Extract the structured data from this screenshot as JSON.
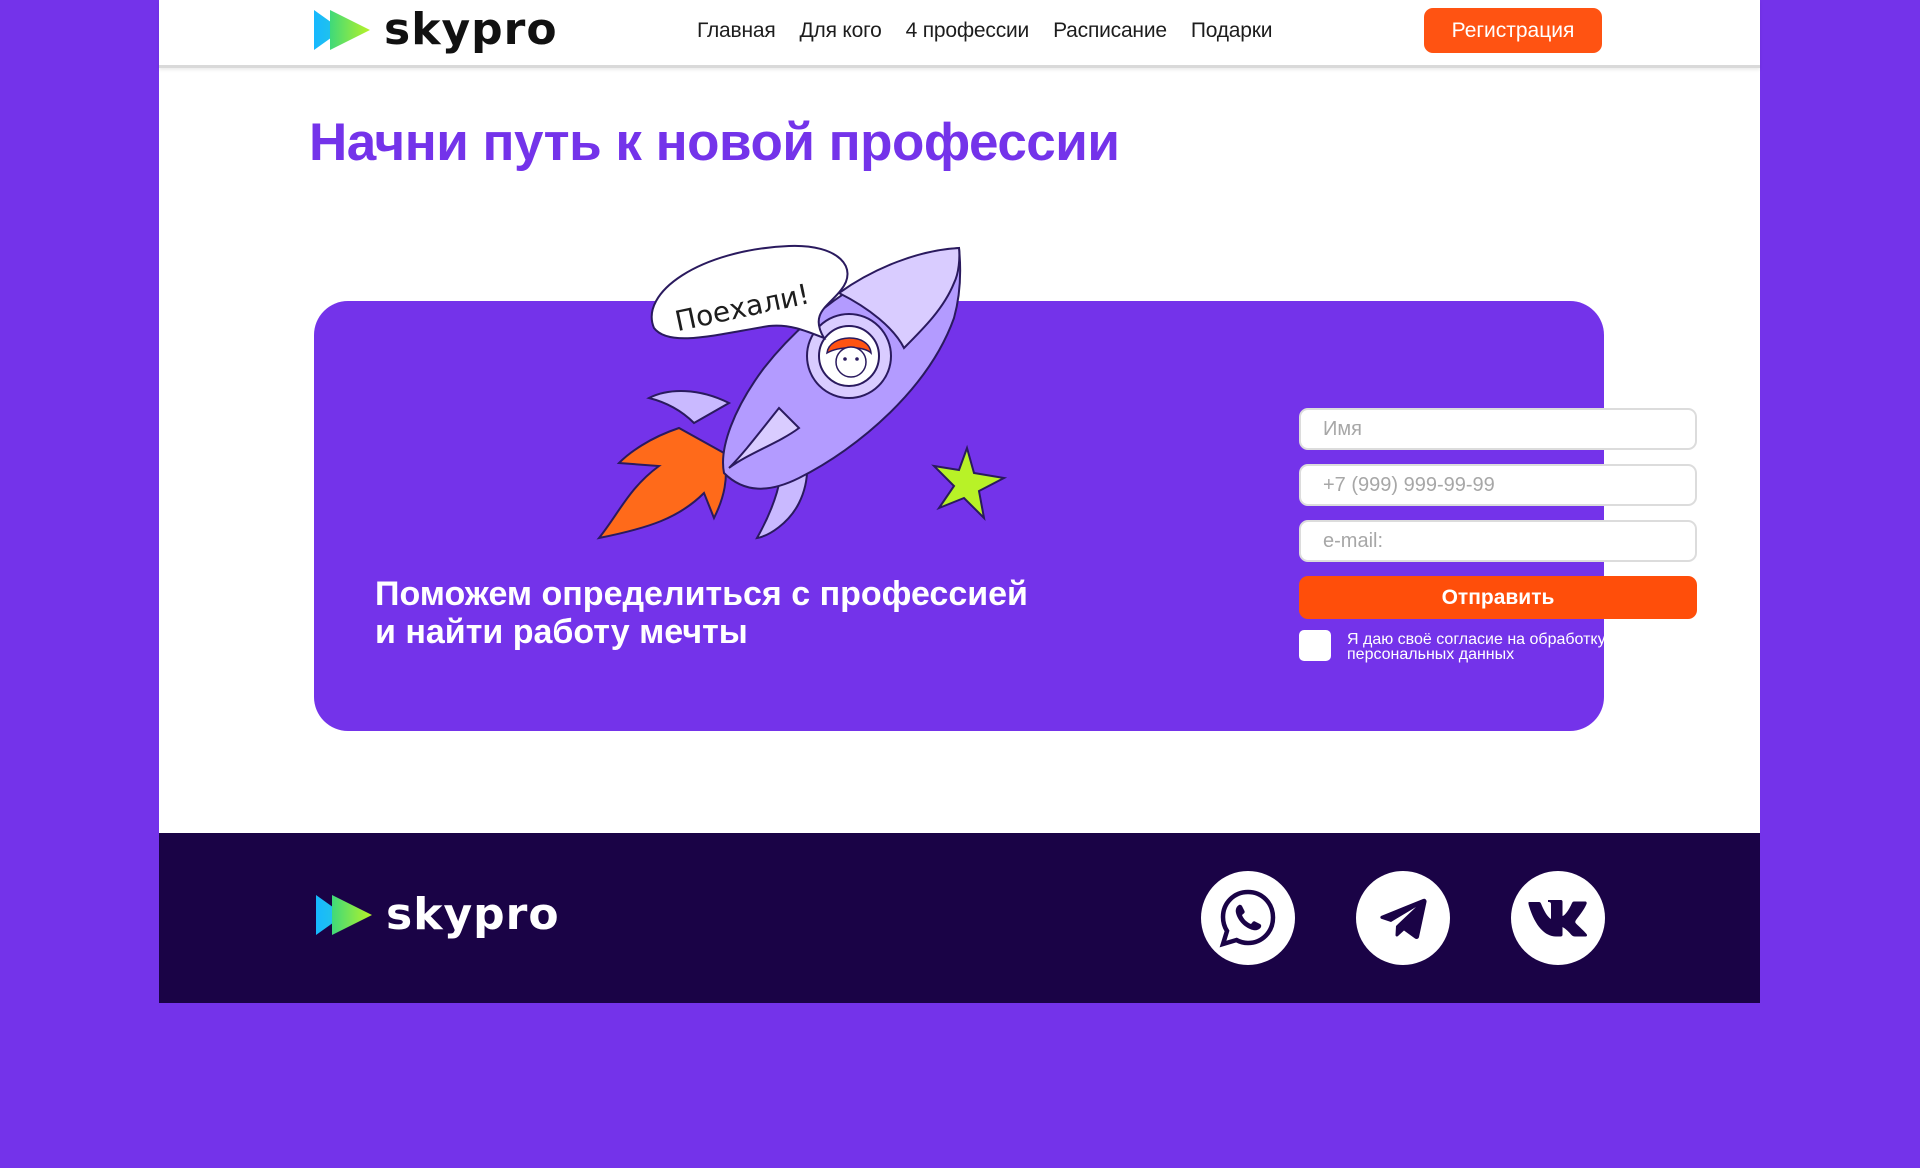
{
  "brand": {
    "name": "skypro"
  },
  "nav": {
    "items": [
      "Главная",
      "Для кого",
      "4 профессии",
      "Расписание",
      "Подарки"
    ],
    "register_label": "Регистрация"
  },
  "hero": {
    "title": "Начни путь к новой профессии",
    "speech_bubble": "Поехали!",
    "subtitle_line1": "Поможем определиться с профессией",
    "subtitle_line2": "и найти работу мечты"
  },
  "form": {
    "name_placeholder": "Имя",
    "phone_placeholder": "+7 (999) 999-99-99",
    "email_placeholder": "e-mail:",
    "submit_label": "Отправить",
    "consent_text": "Я даю своё согласие на обработку персональных данных"
  },
  "footer": {
    "social": [
      "whatsapp-icon",
      "telegram-icon",
      "vk-icon"
    ]
  },
  "colors": {
    "background": "#7433ea",
    "accent": "#ff5312",
    "footer": "#1a0346",
    "title": "#7433ea"
  }
}
